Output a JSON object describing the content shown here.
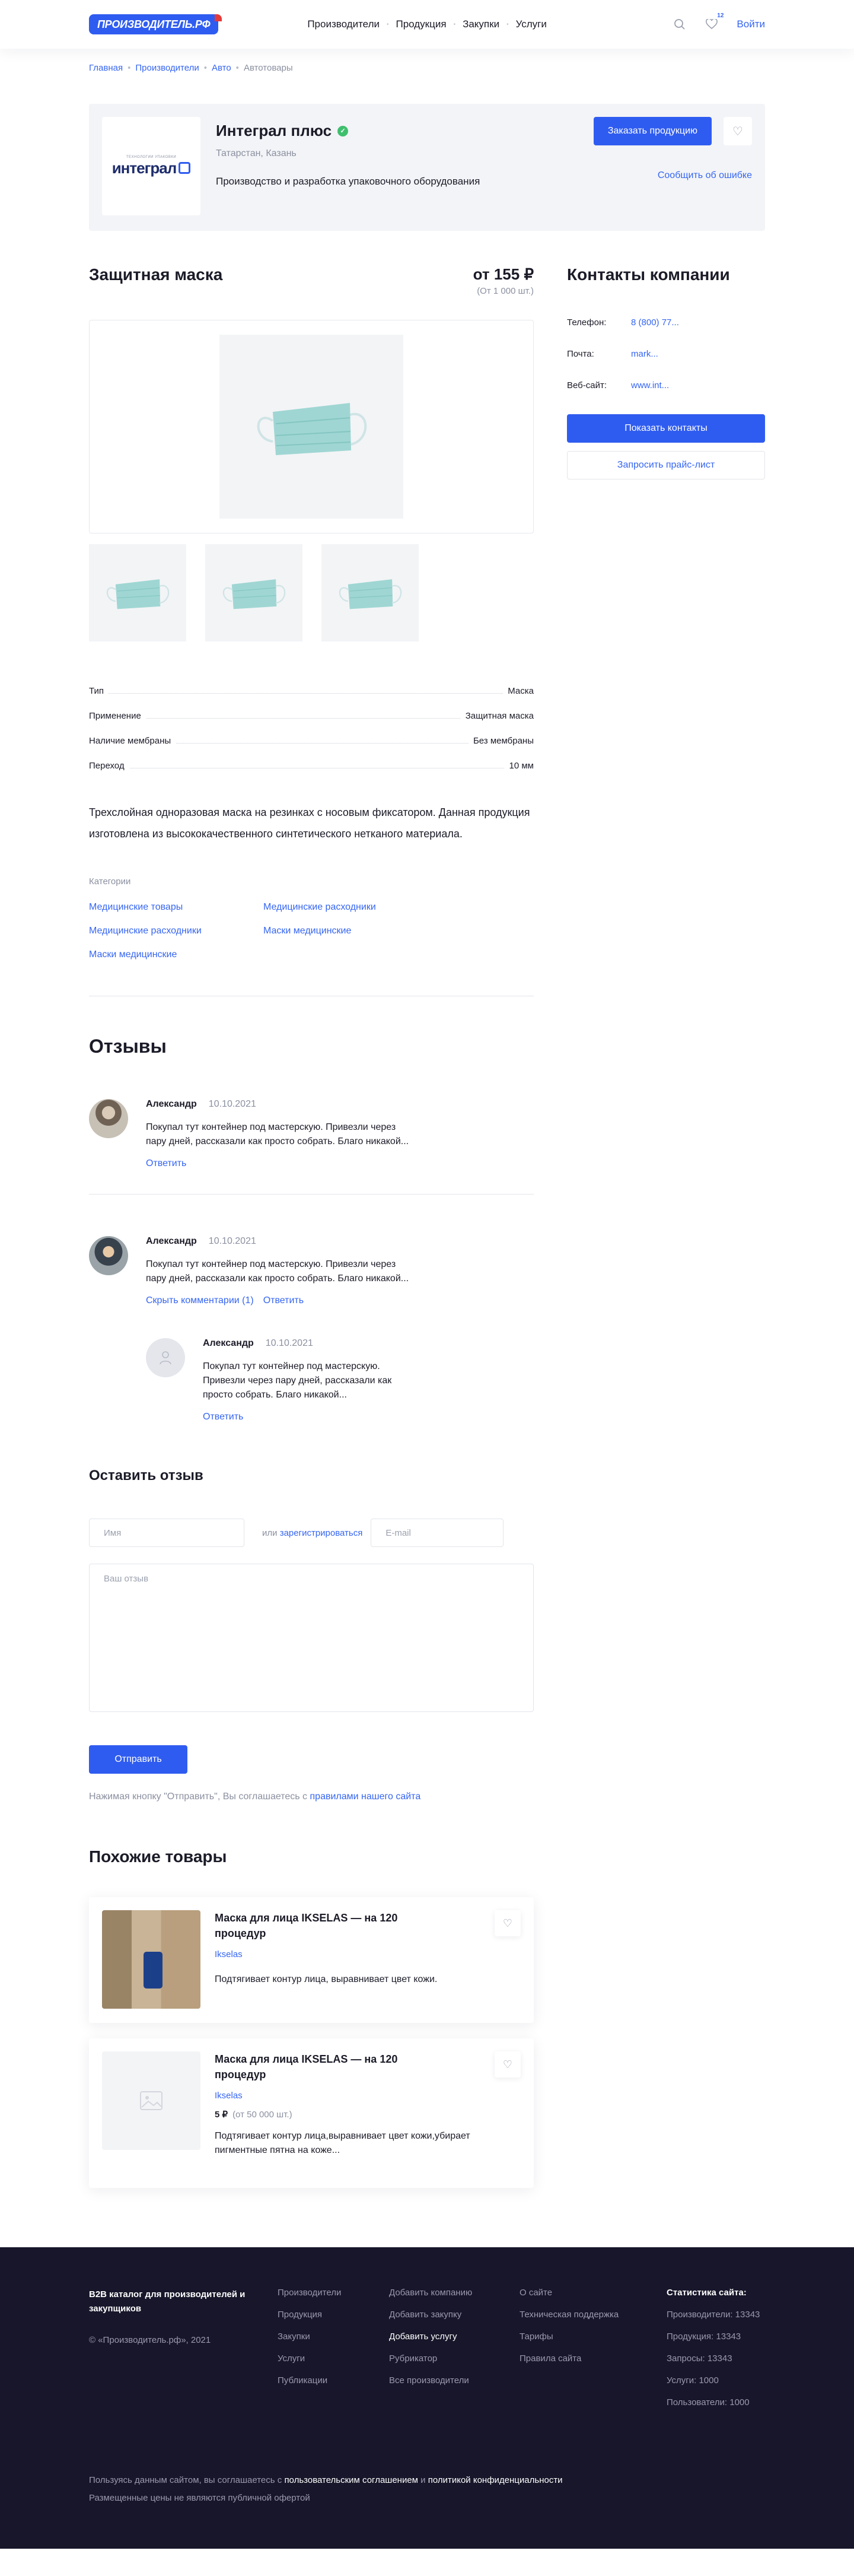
{
  "header": {
    "logo": "ПРОИЗВОДИТЕЛЬ.РФ",
    "nav": [
      "Производители",
      "Продукция",
      "Закупки",
      "Услуги"
    ],
    "fav_count": "12",
    "login": "Войти"
  },
  "breadcrumbs": [
    "Главная",
    "Производители",
    "Авто",
    "Автотовары"
  ],
  "company": {
    "logo_small": "ТЕХНОЛОГИИ УПАКОВКИ",
    "logo_text": "интеграл",
    "name": "Интеграл плюс",
    "location": "Татарстан, Казань",
    "description": "Производство и разработка упаковочного оборудования",
    "order_button": "Заказать продукцию",
    "report": "Сообщить об ошибке"
  },
  "product": {
    "title": "Защитная маска",
    "price": "от 155 ₽",
    "min_order": "(От 1 000 шт.)",
    "props": [
      {
        "k": "Тип",
        "v": "Маска"
      },
      {
        "k": "Применение",
        "v": "Защитная маска"
      },
      {
        "k": "Наличие мембраны",
        "v": "Без мембраны"
      },
      {
        "k": "Переход",
        "v": "10 мм"
      }
    ],
    "description": "Трехслойная одноразовая маска на резинках с  носовым фиксатором. Данная продукция изготовлена из высококачественного синтетического нетканого материала.",
    "categories_title": "Категории",
    "categories": [
      "Медицинские товары",
      "Медицинские расходники",
      "Медицинские расходники",
      "Маски медицинские",
      "Маски медицинские"
    ]
  },
  "contacts": {
    "title": "Контакты компании",
    "phone_label": "Телефон:",
    "phone": "8 (800) 77...",
    "mail_label": "Почта:",
    "mail": "mark...",
    "site_label": "Веб-сайт:",
    "site": "www.int...",
    "show_button": "Показать контакты",
    "price_button": "Запросить прайс-лист"
  },
  "reviews": {
    "title": "Отзывы",
    "items": [
      {
        "name": "Александр",
        "date": "10.10.2021",
        "text": "Покупал тут контейнер под мастерскую. Привезли через пару дней, рассказали как просто собрать. Благо никакой...",
        "reply": "Ответить"
      },
      {
        "name": "Александр",
        "date": "10.10.2021",
        "text": "Покупал тут контейнер под мастерскую. Привезли через пару дней, рассказали как просто собрать. Благо никакой...",
        "hide": "Скрыть комментарии (1)",
        "reply": "Ответить"
      }
    ],
    "nested": {
      "name": "Александр",
      "date": "10.10.2021",
      "text": "Покупал тут контейнер под мастерскую. Привезли через пару дней, рассказали как просто собрать. Благо никакой...",
      "reply": "Ответить"
    }
  },
  "form": {
    "title": "Оставить отзыв",
    "name_placeholder": "Имя",
    "or": "или",
    "register": "зарегистрироваться",
    "email_placeholder": "E-mail",
    "review_placeholder": "Ваш отзыв",
    "send": "Отправить",
    "agree_text": "Нажимая кнопку \"Отправить\", Вы соглашаетесь с",
    "agree_link": "правилами нашего сайта"
  },
  "similar": {
    "title": "Похожие товары",
    "items": [
      {
        "title": "Маска для лица IKSELAS — на 120 процедур",
        "brand": "Ikselas",
        "text": "Подтягивает контур лица, выравнивает цвет кожи."
      },
      {
        "title": "Маска для лица IKSELAS — на 120 процедур",
        "brand": "Ikselas",
        "price": "5 ₽",
        "min": "(от 50 000 шт.)",
        "text": "Подтягивает контур лица,выравнивает цвет кожи,убирает пигментные пятна на коже..."
      }
    ]
  },
  "footer": {
    "about": "B2B каталог для производителей и закупщиков",
    "copyright": "© «Производитель.рф», 2021",
    "col1": [
      "Производители",
      "Продукция",
      "Закупки",
      "Услуги",
      "Публикации"
    ],
    "col2": [
      "Добавить компанию",
      "Добавить закупку",
      "Добавить услугу",
      "Рубрикатор",
      "Все производители"
    ],
    "col3": [
      "О сайте",
      "Техническая поддержка",
      "Тарифы",
      "Правила сайта"
    ],
    "stats_title": "Статистика сайта:",
    "stats": [
      "Производители: 13343",
      "Продукция: 13343",
      "Запросы: 13343",
      "Услуги: 1000",
      "Пользователи: 1000"
    ],
    "bottom1_pre": "Пользуясь данным сайтом, вы соглашаетесь с",
    "bottom1_link1": "пользовательским соглашением",
    "bottom1_and": "и",
    "bottom1_link2": "политикой конфиденциальности",
    "bottom2": "Размещенные цены не являются публичной офертой"
  }
}
